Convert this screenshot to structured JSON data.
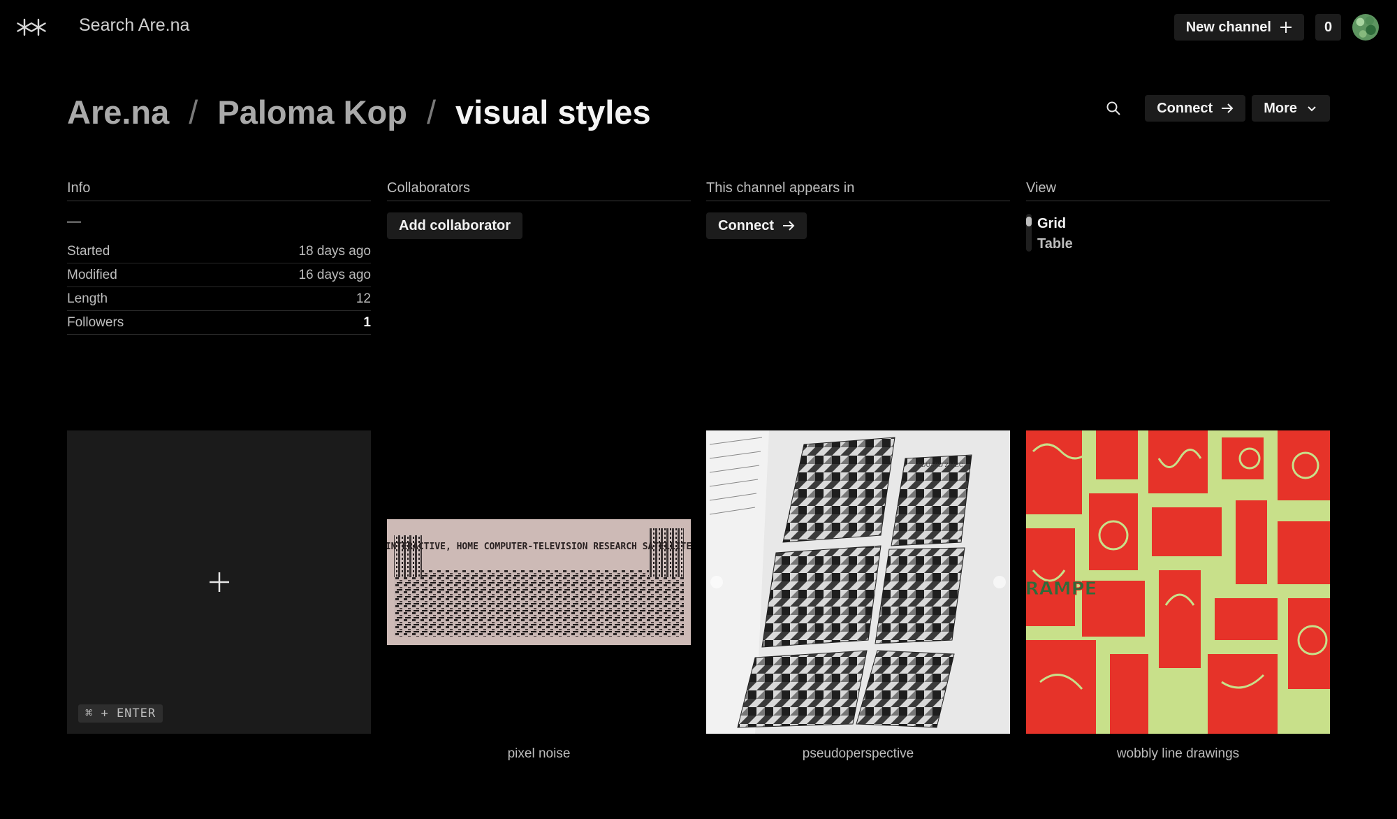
{
  "topbar": {
    "search_label": "Search Are.na",
    "new_channel_label": "New channel",
    "notification_count": "0"
  },
  "breadcrumb": {
    "items": [
      "Are.na",
      "Paloma Kop",
      "visual styles"
    ],
    "separator": "/"
  },
  "header_actions": {
    "connect_label": "Connect",
    "more_label": "More"
  },
  "info": {
    "title": "Info",
    "description": "—",
    "rows": [
      {
        "label": "Started",
        "value": "18 days ago"
      },
      {
        "label": "Modified",
        "value": "16 days ago"
      },
      {
        "label": "Length",
        "value": "12"
      },
      {
        "label": "Followers",
        "value": "1"
      }
    ]
  },
  "collaborators": {
    "title": "Collaborators",
    "add_label": "Add collaborator"
  },
  "appears_in": {
    "title": "This channel appears in",
    "connect_label": "Connect"
  },
  "view": {
    "title": "View",
    "options": [
      "Grid",
      "Table"
    ],
    "selected": "Grid"
  },
  "grid": {
    "add_shortcut": "⌘ + ENTER",
    "blocks": [
      {
        "caption": "pixel noise",
        "image_text": "\"AN INTERACTIVE, HOME COMPUTER-TELEVISION RESEARCH SATELLITE...\""
      },
      {
        "caption": "pseudoperspective",
        "image_text": "EDUARD ZAJEC"
      },
      {
        "caption": "wobbly line drawings",
        "image_text": "RAMPE"
      }
    ]
  },
  "colors": {
    "background": "#000000",
    "button_bg": "#1c1c1c",
    "muted_text": "#bdbdbd",
    "block_red": "#e63329",
    "block_green": "#c8e08a"
  }
}
